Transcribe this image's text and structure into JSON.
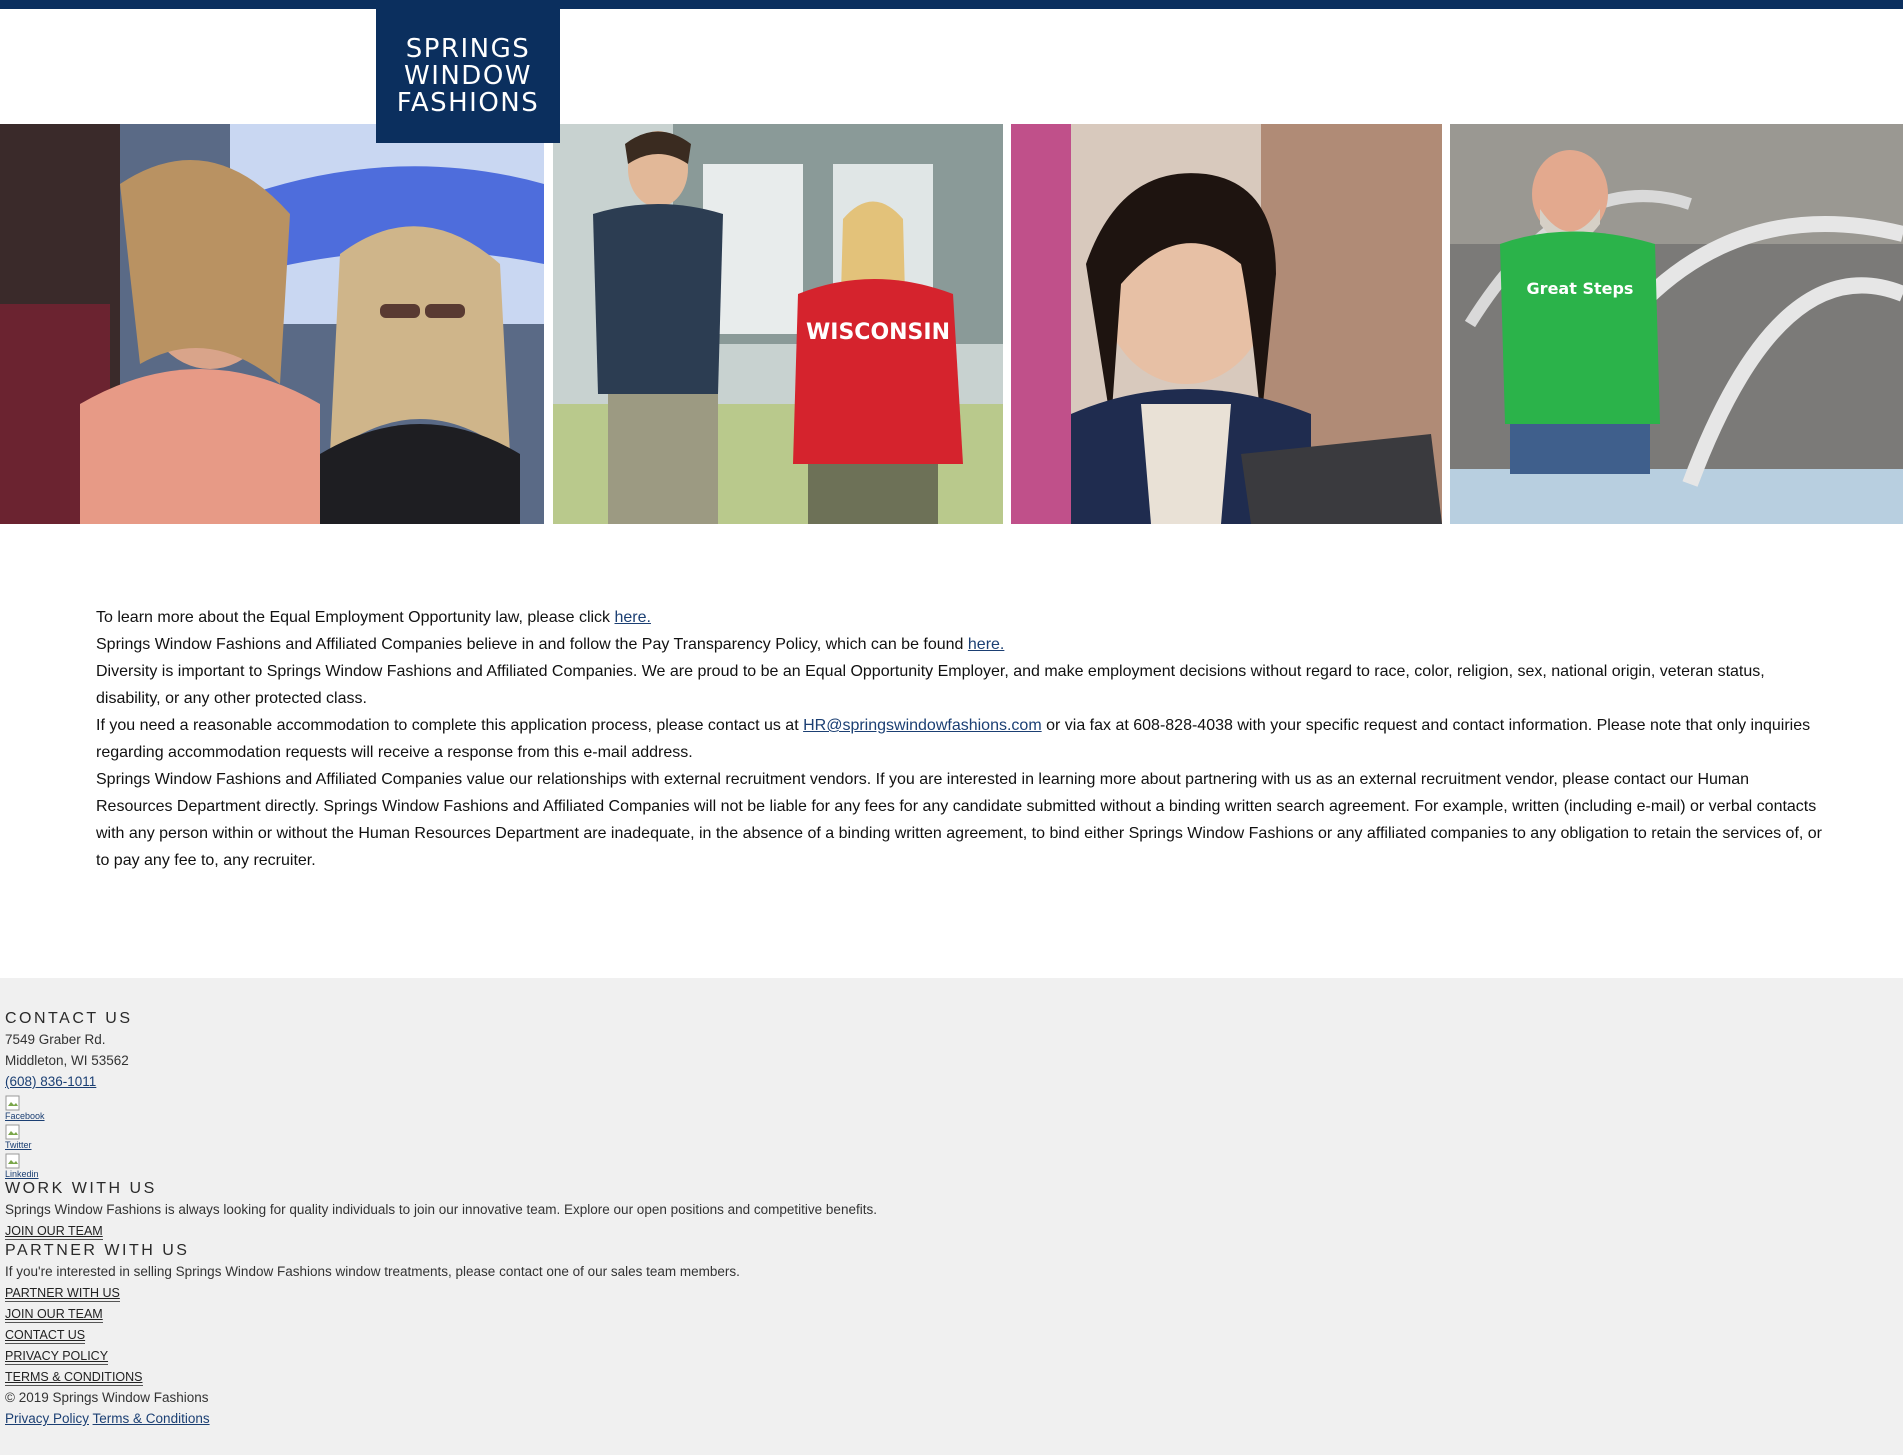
{
  "header": {
    "logo_lines": [
      "SPRINGS",
      "WINDOW",
      "FASHIONS"
    ]
  },
  "colors": {
    "navy": "#0b2f5e",
    "link": "#1b3f73",
    "footer_bg": "#f0f0f0"
  },
  "content": {
    "p1_text": "To learn more about the Equal Employment Opportunity law, please click ",
    "p1_link": "here.",
    "p2_text": "Springs Window Fashions and Affiliated Companies believe in and follow the Pay Transparency Policy, which can be found ",
    "p2_link": "here.",
    "p3_text": "Diversity is important to Springs Window Fashions and Affiliated Companies. We are proud to be an Equal Opportunity Employer, and make employment decisions without regard to race, color, religion, sex, national origin, veteran status, disability, or any other protected class.",
    "p4_text_a": "If you need a reasonable accommodation to complete this application process, please contact us at ",
    "p4_email": "HR@springswindowfashions.com",
    "p4_text_b": " or via fax at 608-828-4038 with your specific request and contact information. Please note that only inquiries regarding accommodation requests will receive a response from this e-mail address.",
    "p5_text": "Springs Window Fashions and Affiliated Companies value our relationships with external recruitment vendors. If you are interested in learning more about partnering with us as an external recruitment vendor, please contact our Human Resources Department directly. Springs Window Fashions and Affiliated Companies will not be liable for any fees for any candidate submitted without a binding written search agreement. For example, written (including e-mail) or verbal contacts with any person within or without the Human Resources Department are inadequate, in the absence of a binding written agreement, to bind either Springs Window Fashions or any affiliated companies to any obligation to retain the services of, or to pay any fee to, any recruiter."
  },
  "footer": {
    "contact_heading": "CONTACT US",
    "address_1": "7549 Graber Rd.",
    "address_2": "Middleton, WI 53562",
    "phone": "(608) 836-1011",
    "social": [
      "Facebook",
      "Twitter",
      "Linkedin"
    ],
    "work_heading": "WORK WITH US",
    "work_text": "Springs Window Fashions is always looking for quality individuals to join our innovative team. Explore our open positions and competitive benefits.",
    "work_link": "JOIN OUR TEAM",
    "partner_heading": "PARTNER WITH US",
    "partner_text": "If you're interested in selling Springs Window Fashions window treatments, please contact one of our sales team members.",
    "nav": [
      "PARTNER WITH US",
      "JOIN OUR TEAM",
      "CONTACT US",
      "PRIVACY POLICY",
      "TERMS & CONDITIONS"
    ],
    "copyright": "© 2019 Springs Window Fashions",
    "bottom_links": [
      "Privacy Policy",
      "Terms & Conditions"
    ]
  }
}
